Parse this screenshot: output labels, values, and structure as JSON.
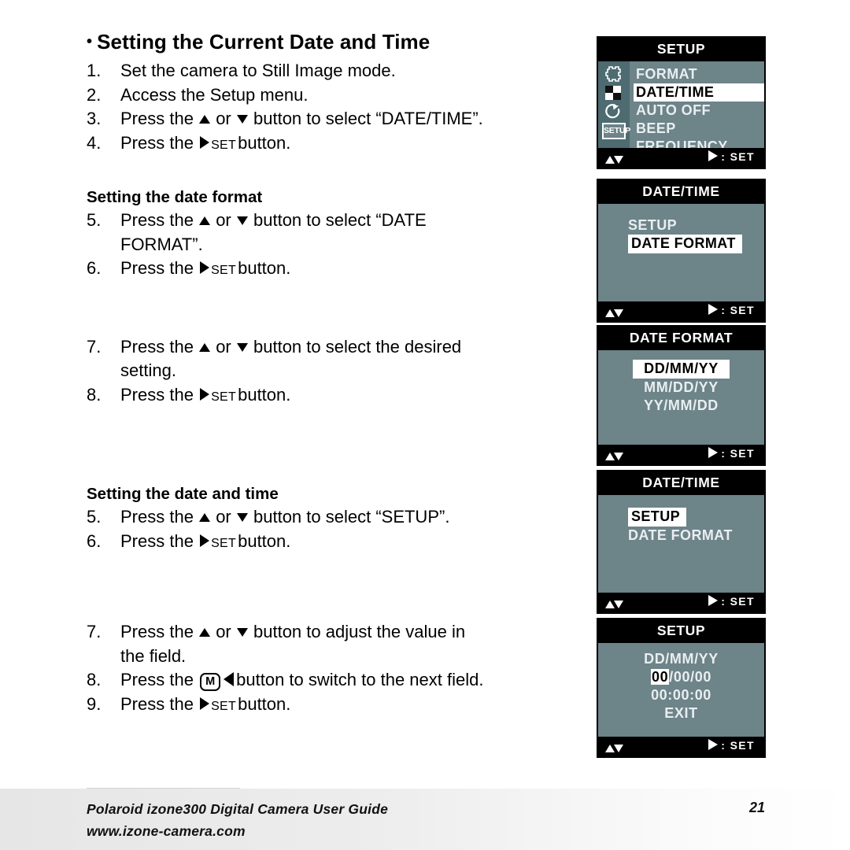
{
  "document": {
    "title": "Setting the Current Date and Time",
    "bullet": "•"
  },
  "sections": {
    "intro_steps": [
      {
        "num": "1.",
        "pre": "Set the camera to Still Image mode.",
        "post": ""
      },
      {
        "num": "2.",
        "pre": "Access the Setup menu.",
        "post": ""
      },
      {
        "num": "3.",
        "pre": "Press the",
        "mid": "or",
        "post": "button to select “DATE/TIME”."
      },
      {
        "num": "4.",
        "pre": "Press the",
        "set": "SET",
        "post": "button."
      }
    ],
    "date_format": {
      "heading": "Setting the date format",
      "steps": [
        {
          "num": "5.",
          "pre": "Press the",
          "mid": "or",
          "post": "button to select “DATE",
          "cont": "FORMAT”."
        },
        {
          "num": "6.",
          "pre": "Press the",
          "set": "SET",
          "post": "button."
        },
        {
          "num": "7.",
          "pre": "Press the",
          "mid": "or",
          "post": "button to select the desired",
          "cont": "setting."
        },
        {
          "num": "8.",
          "pre": "Press the",
          "set": "SET",
          "post": "button."
        }
      ]
    },
    "date_and_time": {
      "heading": "Setting the date and time",
      "steps": [
        {
          "num": "5.",
          "pre": "Press the",
          "mid": "or",
          "post": "button to select “SETUP”."
        },
        {
          "num": "6.",
          "pre": "Press the",
          "set": "SET",
          "post": "button."
        },
        {
          "num": "7.",
          "pre": "Press the",
          "mid": "or",
          "post": "button to adjust the value in",
          "cont": "the field."
        },
        {
          "num": "8.",
          "pre": "Press the",
          "mbtn": "M",
          "post": "button to switch to the next field."
        },
        {
          "num": "9.",
          "pre": "Press the",
          "set": "SET",
          "post": "button."
        }
      ]
    }
  },
  "lcd_footer": {
    "set_label": ": SET"
  },
  "panels": [
    {
      "id": "setup-menu",
      "title": "SETUP",
      "rail_icons": [
        "resolution-icon",
        "quality-checker-icon",
        "self-timer-icon",
        "setup-tab-icon"
      ],
      "setup_tab_label": "SETUP",
      "items": [
        {
          "label": "FORMAT",
          "selected": false
        },
        {
          "label": "DATE/TIME",
          "selected": true
        },
        {
          "label": "AUTO OFF",
          "selected": false
        },
        {
          "label": "BEEP",
          "selected": false
        },
        {
          "label": "FREQUENCY",
          "selected": false
        }
      ]
    },
    {
      "id": "datetime-dateformat",
      "title": "DATE/TIME",
      "items": [
        {
          "label": "SETUP",
          "selected": false
        },
        {
          "label": "DATE FORMAT",
          "selected": true
        }
      ]
    },
    {
      "id": "date-format-options",
      "title": "DATE FORMAT",
      "items": [
        {
          "label": "DD/MM/YY",
          "selected": true
        },
        {
          "label": "MM/DD/YY",
          "selected": false
        },
        {
          "label": "YY/MM/DD",
          "selected": false
        }
      ]
    },
    {
      "id": "datetime-setup",
      "title": "DATE/TIME",
      "items": [
        {
          "label": "SETUP",
          "selected": true
        },
        {
          "label": "DATE FORMAT",
          "selected": false
        }
      ]
    },
    {
      "id": "setup-clock",
      "title": "SETUP",
      "format_line": "DD/MM/YY",
      "date_field_selected": "00",
      "date_field_rest": "/00/00",
      "time_line": "00:00:00",
      "exit_label": "EXIT"
    }
  ],
  "footer": {
    "guide": "Polaroid izone300 Digital Camera User Guide",
    "url": "www.izone-camera.com",
    "page": "21"
  },
  "colors": {
    "lcd_body": "#6d8489",
    "lcd_rail": "#4d6b70",
    "lcd_bar": "#000000",
    "lcd_text": "#e9eef0",
    "selected_bg": "#ffffff"
  }
}
